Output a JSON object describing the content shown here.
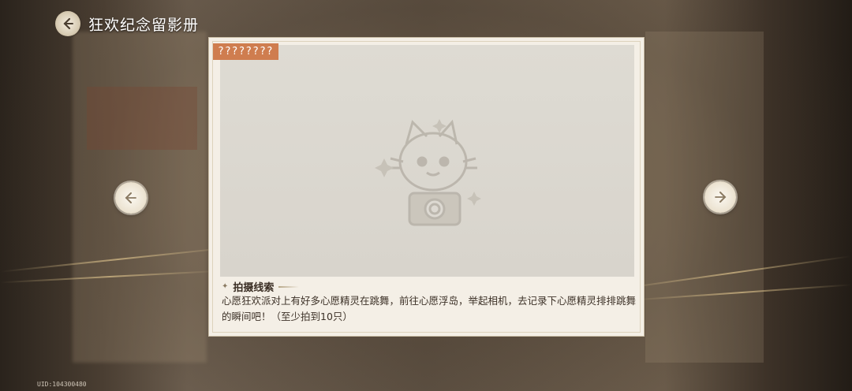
{
  "header": {
    "title": "狂欢纪念留影册",
    "back_icon": "back-arrow-icon"
  },
  "card": {
    "tag_label": "????????",
    "clue_heading": "拍摄线索",
    "clue_text": "心愿狂欢派对上有好多心愿精灵在跳舞，前往心愿浮岛，举起相机，去记录下心愿精灵排排跳舞的瞬间吧！（至少拍到10只）",
    "placeholder_icon": "cat-camera-placeholder-icon"
  },
  "nav": {
    "prev_icon": "arrow-left-icon",
    "next_icon": "arrow-right-icon"
  },
  "footer": {
    "uid": "UID:104300480"
  },
  "colors": {
    "tag_bg": "#cf7d4f",
    "card_bg": "#f4efe6",
    "photo_bg": "#dedbd3"
  }
}
